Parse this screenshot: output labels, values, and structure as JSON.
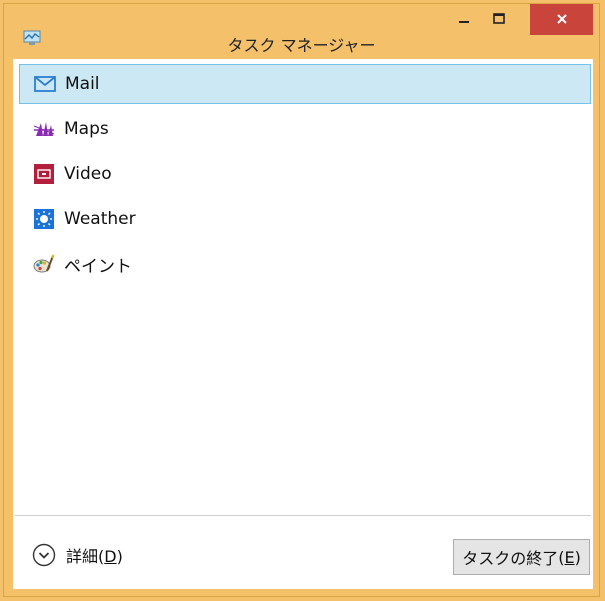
{
  "window": {
    "title": "タスク マネージャー"
  },
  "list": {
    "items": [
      {
        "label": "Mail",
        "icon": "mail-icon",
        "selected": true
      },
      {
        "label": "Maps",
        "icon": "maps-icon",
        "selected": false
      },
      {
        "label": "Video",
        "icon": "video-icon",
        "selected": false
      },
      {
        "label": "Weather",
        "icon": "weather-icon",
        "selected": false
      },
      {
        "label": "ペイント",
        "icon": "paint-icon",
        "selected": false
      }
    ]
  },
  "footer": {
    "details_label": "詳細",
    "details_accel": "D",
    "end_task_label": "タスクの終了",
    "end_task_accel": "E"
  },
  "colors": {
    "frame": "#f4c16a",
    "close_button": "#c9453b",
    "selection_bg": "#cce8f5",
    "selection_border": "#77c0e8",
    "mail_icon": "#2a7ed3",
    "maps_icon": "#8a2bb3",
    "video_icon": "#b41e3d",
    "weather_icon": "#1a73d9"
  }
}
